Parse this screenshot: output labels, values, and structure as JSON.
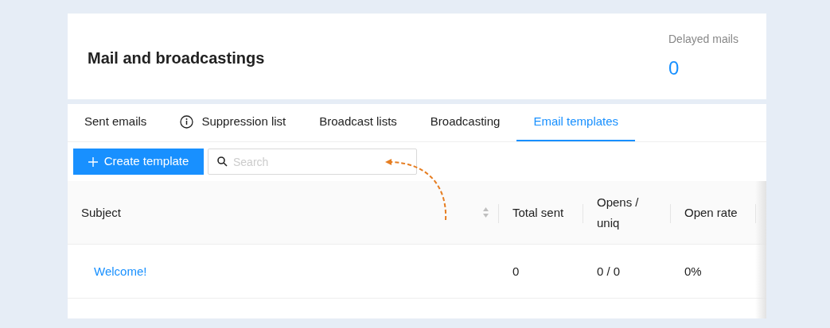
{
  "header": {
    "title": "Mail and broadcastings",
    "stat_label": "Delayed mails",
    "stat_value": "0"
  },
  "tabs": [
    {
      "label": "Sent emails",
      "kind": "plain",
      "selected": false
    },
    {
      "label": "Suppression list",
      "kind": "info",
      "selected": false
    },
    {
      "label": "Broadcast lists",
      "kind": "plain",
      "selected": false
    },
    {
      "label": "Broadcasting",
      "kind": "plain",
      "selected": false
    },
    {
      "label": "Email templates",
      "kind": "plain",
      "selected": true
    }
  ],
  "toolbar": {
    "create_button": "Create template",
    "search": {
      "placeholder": "Search"
    }
  },
  "table": {
    "columns": [
      {
        "label": "Subject",
        "sortable": true
      },
      {
        "label": "Total sent",
        "sortable": false
      },
      {
        "label": "Opens / uniq",
        "sortable": false
      },
      {
        "label": "Open rate",
        "sortable": false
      }
    ],
    "rows": [
      {
        "subject": "Welcome!",
        "total_sent": "0",
        "opens": "0 / 0",
        "open_rate": "0%"
      }
    ]
  }
}
